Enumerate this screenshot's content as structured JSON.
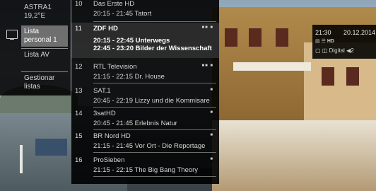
{
  "satellite_menu": {
    "header_line1": "ASTRA1",
    "header_line2": "19,2°E",
    "items": [
      {
        "label": "Lista personal 1"
      },
      {
        "label": "Lista AV"
      },
      {
        "label": "Gestionar listas"
      }
    ]
  },
  "channels": [
    {
      "number": "10",
      "name": "Das Erste HD",
      "program": "20:15 - 21:45  Tatort",
      "program2": ""
    },
    {
      "number": "11",
      "name": "ZDF HD",
      "program": "20:15 - 22:45  Unterwegs",
      "program2": "22:45 - 23:20  Bilder der Wissenschaft"
    },
    {
      "number": "12",
      "name": "RTL Television",
      "program": "21:15 - 22:15  Dr. House",
      "program2": ""
    },
    {
      "number": "13",
      "name": "SAT.1",
      "program": "20:45 - 22:19  Lizzy und die Kommisare",
      "program2": ""
    },
    {
      "number": "14",
      "name": "3satHD",
      "program": "20:45 - 21:45  Erlebnis Natur",
      "program2": ""
    },
    {
      "number": "15",
      "name": "BR Nord HD",
      "program": "21:15 - 21:45  Vor Ort - Die Reportage",
      "program2": ""
    },
    {
      "number": "16",
      "name": "ProSieben",
      "program": "21:15 - 22:15  The Big Bang Theory",
      "program2": ""
    }
  ],
  "info_box": {
    "time": "21:30",
    "date": "20.12.2014",
    "format_label": "HD",
    "audio_label": "Digital",
    "audio_count": "2"
  }
}
